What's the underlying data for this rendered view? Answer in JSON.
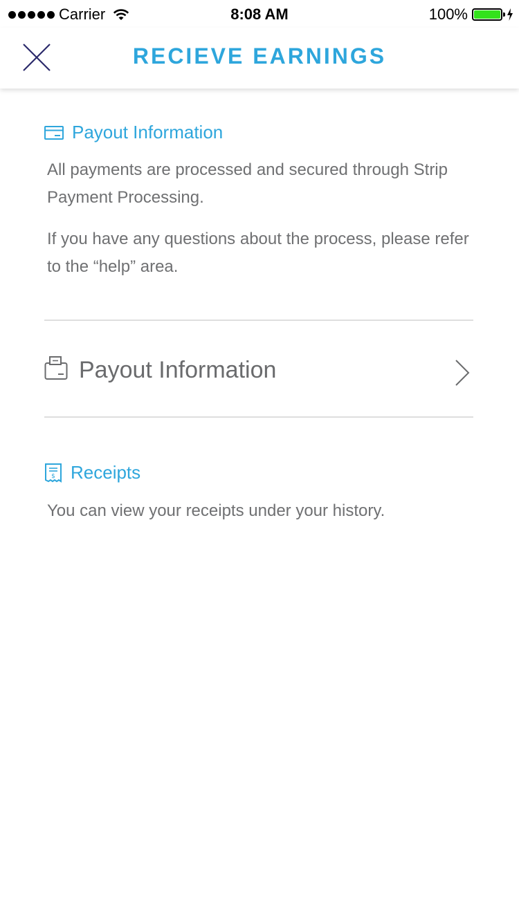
{
  "status_bar": {
    "carrier": "Carrier",
    "time": "8:08 AM",
    "battery": "100%",
    "battery_level": 1.0
  },
  "header": {
    "title": "RECIEVE EARNINGS",
    "close_icon": "close-icon"
  },
  "sections": {
    "payout_info": {
      "icon": "credit-card-icon",
      "title": "Payout Information",
      "paragraph1": "All payments are processed and secured through Strip Payment Processing.",
      "paragraph2": "If you have any questions about the process, please refer to the “help” area."
    },
    "payout_row": {
      "icon": "wallet-icon",
      "label": "Payout Information",
      "chevron": "chevron-right-icon"
    },
    "receipts": {
      "icon": "receipt-icon",
      "title": "Receipts",
      "paragraph": "You can view your receipts under your history."
    }
  },
  "colors": {
    "accent": "#2ea6dc",
    "close_icon": "#2b2a6b",
    "body_text": "#6f7072",
    "divider": "#dedede",
    "battery": "#33e21c"
  }
}
